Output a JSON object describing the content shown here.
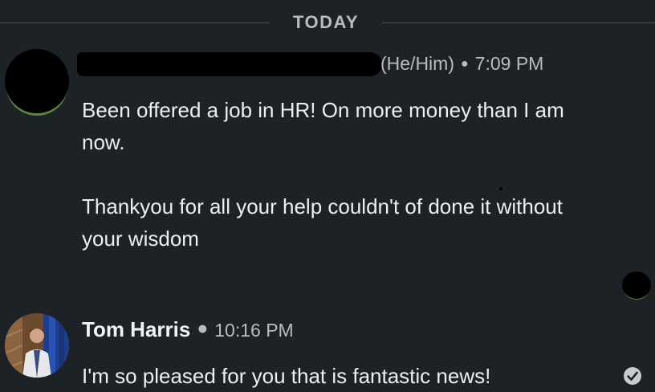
{
  "divider": {
    "label": "TODAY"
  },
  "messages": [
    {
      "sender_suffix": "(He/Him)",
      "time": "7:09 PM",
      "paragraphs": [
        "Been offered a job in HR! On more money than I am now.",
        "Thankyou for all your help couldn't of done it without your wisdom"
      ]
    },
    {
      "sender": "Tom Harris",
      "time": "10:16 PM",
      "paragraphs": [
        "I'm so pleased for you that is fantastic news!"
      ]
    }
  ],
  "icons": {
    "sent_status": "check-circle-icon"
  },
  "colors": {
    "background": "#1d2226",
    "text": "#eceff1",
    "muted": "#b8bcc0",
    "divider": "#4a4f54"
  }
}
